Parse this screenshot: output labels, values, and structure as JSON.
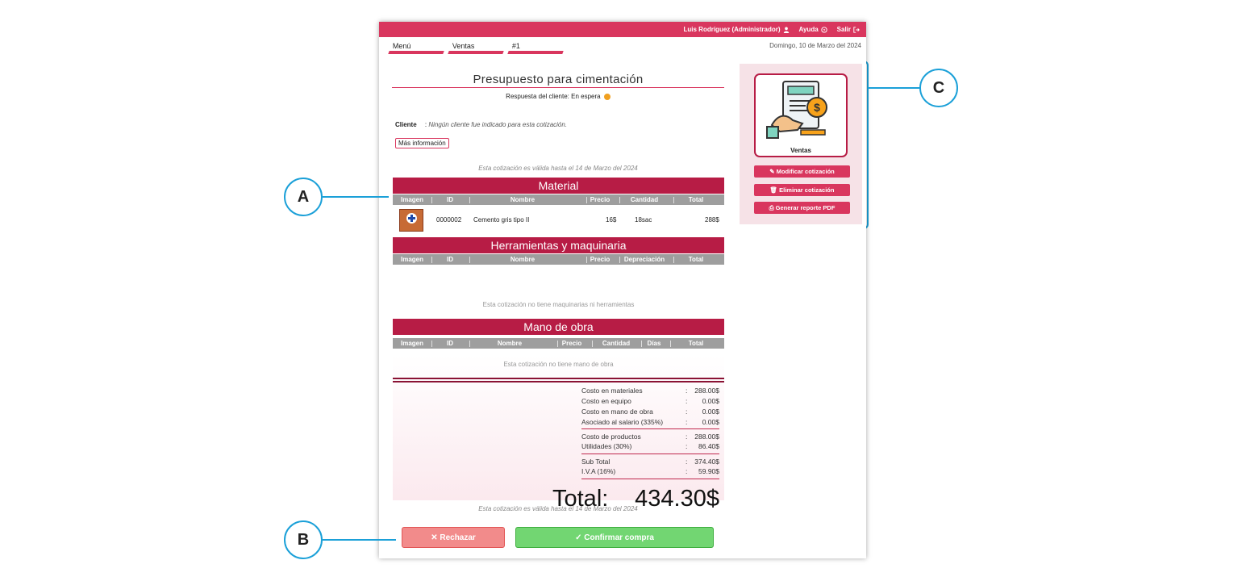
{
  "topbar": {
    "user": "Luis Rodríguez (Administrador)",
    "help": "Ayuda",
    "logout": "Salir"
  },
  "breadcrumb": [
    "Menú",
    "Ventas",
    "#1"
  ],
  "date": "Domingo, 10 de Marzo del 2024",
  "quote": {
    "title": "Presupuesto para cimentación",
    "response_label": "Respuesta del cliente: En espera",
    "client_label": "Cliente",
    "client_sep": ":",
    "client_value": "Ningún cliente fue indicado para esta cotización.",
    "more_info": "Más información",
    "valid_until": "Esta cotización es válida hasta el 14 de Marzo del 2024"
  },
  "sections": {
    "material": {
      "title": "Material",
      "columns": [
        "Imagen",
        "ID",
        "Nombre",
        "Precio",
        "Cantidad",
        "Total"
      ],
      "rows": [
        {
          "id": "0000002",
          "name": "Cemento gris tipo II",
          "price": "16$",
          "qty": "18sac",
          "total": "288$"
        }
      ]
    },
    "tools": {
      "title": "Herramientas y maquinaria",
      "columns": [
        "Imagen",
        "ID",
        "Nombre",
        "Precio",
        "Depreciación",
        "Total"
      ],
      "empty": "Esta cotización no tiene maquinarias ni herramientas"
    },
    "labor": {
      "title": "Mano de obra",
      "columns": [
        "Imagen",
        "ID",
        "Nombre",
        "Precio",
        "Cantidad",
        "Días",
        "Total"
      ],
      "empty": "Esta cotización no tiene mano de obra"
    }
  },
  "summary": {
    "group1": [
      {
        "label": "Costo en materiales",
        "sep": ":",
        "value": "288.00$"
      },
      {
        "label": "Costo en equipo",
        "sep": ":",
        "value": "0.00$"
      },
      {
        "label": "Costo en mano de obra",
        "sep": ":",
        "value": "0.00$"
      },
      {
        "label": "Asociado al salario (335%)",
        "sep": ":",
        "value": "0.00$"
      }
    ],
    "group2": [
      {
        "label": "Costo de productos",
        "sep": ":",
        "value": "288.00$"
      },
      {
        "label": "Utilidades (30%)",
        "sep": ":",
        "value": "86.40$"
      }
    ],
    "group3": [
      {
        "label": "Sub Total",
        "sep": ":",
        "value": "374.40$"
      },
      {
        "label": "I.V.A (16%)",
        "sep": ":",
        "value": "59.90$"
      }
    ],
    "total_label": "Total:",
    "total_value": "434.30$"
  },
  "actions": {
    "reject": "✕ Rechazar",
    "confirm": "✓ Confirmar compra"
  },
  "side_panel": {
    "card_label": "Ventas",
    "buttons": [
      "✎ Modificar cotización",
      "🗑 Eliminar cotización",
      "⎙ Generar reporte PDF"
    ]
  },
  "callouts": [
    "A",
    "B",
    "C"
  ],
  "colors": {
    "brand": "#d9365e",
    "section": "#b71c45",
    "highlight": "#1ba0d8",
    "reject": "#f28b8b",
    "confirm": "#72d672"
  }
}
